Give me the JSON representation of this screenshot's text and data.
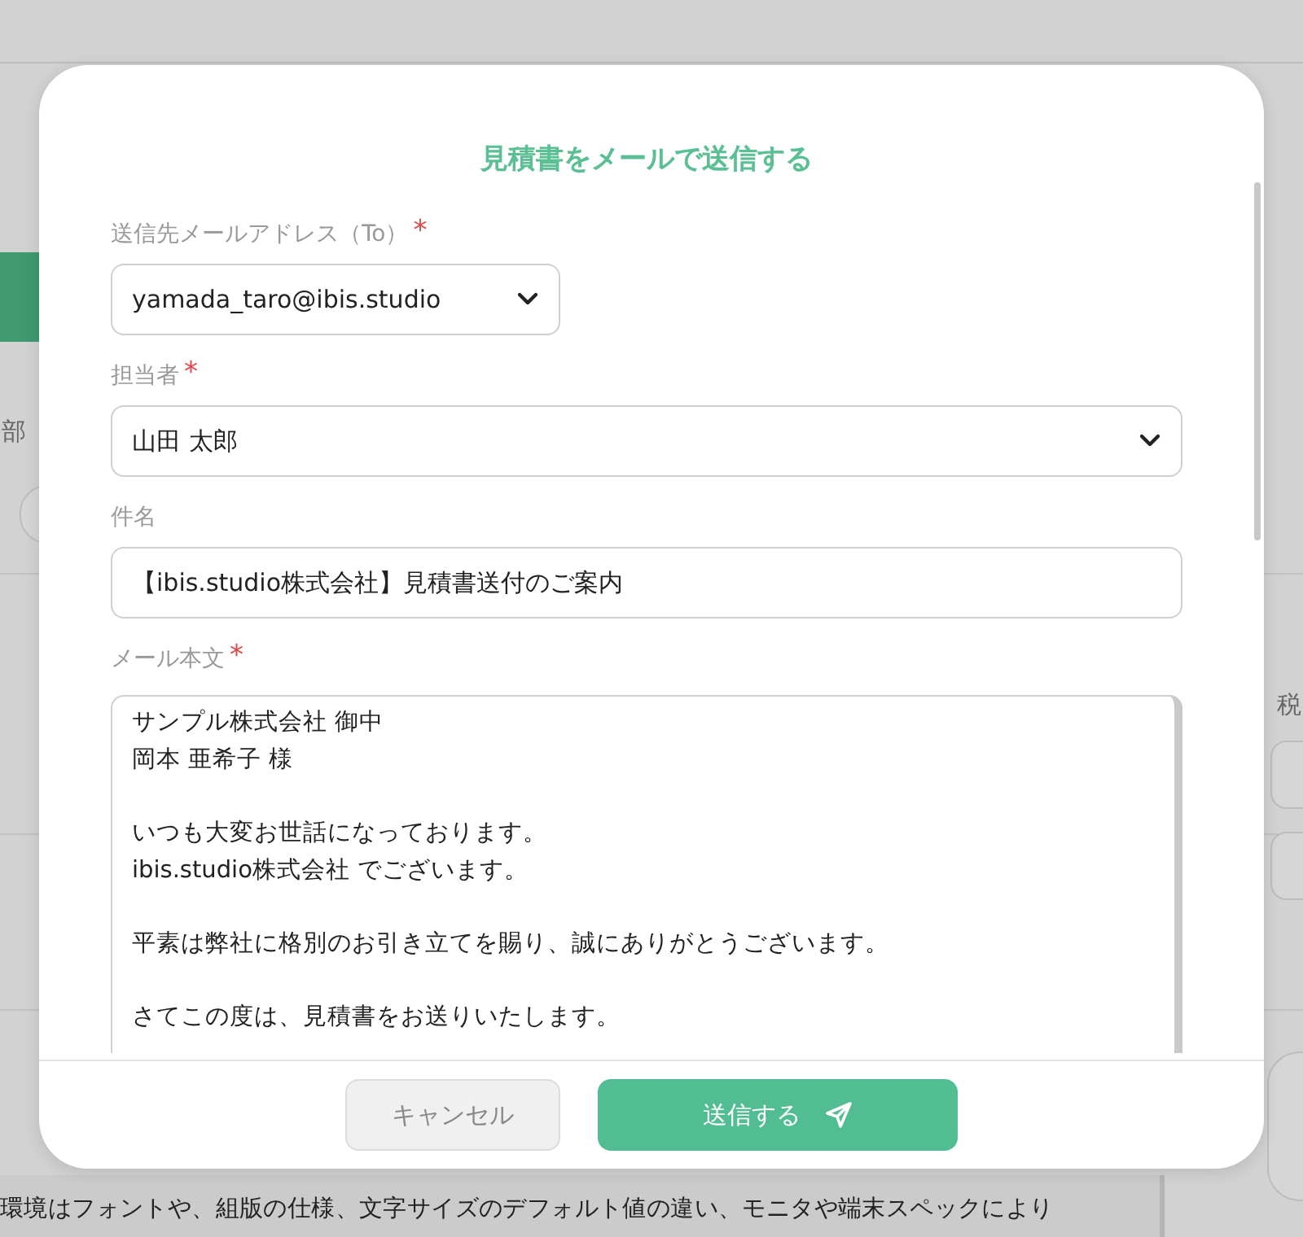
{
  "background": {
    "label_left": "部",
    "label_right": "税",
    "notice": "環境はフォントや、組版の仕様、文字サイズのデフォルト値の違い、モニタや端末スペックにより"
  },
  "dialog": {
    "title": "見積書をメールで送信する",
    "fields": [
      {
        "kind": "select",
        "label": "送信先メールアドレス（To）",
        "required_mark": "*",
        "value": "yamada_taro@ibis.studio"
      },
      {
        "kind": "select",
        "label": "担当者",
        "required_mark": "*",
        "value": "山田 太郎"
      },
      {
        "kind": "text",
        "label": "件名",
        "value": "【ibis.studio株式会社】見積書送付のご案内"
      },
      {
        "kind": "textarea",
        "label": "メール本文",
        "required_mark": "*",
        "paragraphs": [
          [
            "サンプル株式会社 御中",
            "岡本 亜希子 様"
          ],
          [
            "いつも大変お世話になっております。",
            "ibis.studio株式会社 でございます。"
          ],
          [
            "平素は弊社に格別のお引き立てを賜り、誠にありがとうございます。"
          ],
          [
            "さてこの度は、見積書をお送りいたします。"
          ]
        ]
      }
    ],
    "buttons": [
      {
        "kind": "secondary",
        "label": "キャンセル"
      },
      {
        "kind": "primary",
        "label": "送信する"
      }
    ]
  }
}
